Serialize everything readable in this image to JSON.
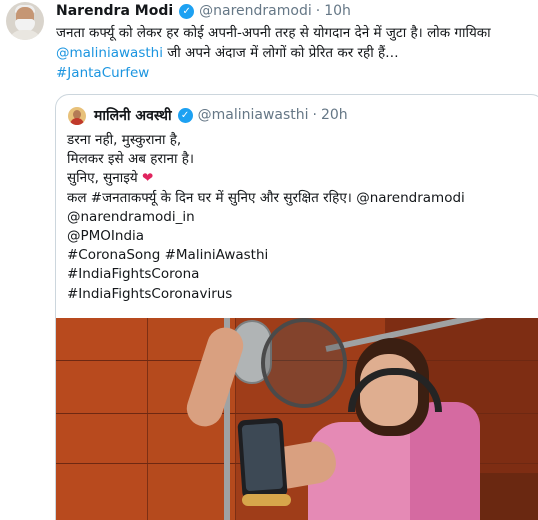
{
  "tweet": {
    "author_name": "Narendra Modi",
    "author_handle": "@narendramodi",
    "separator": "·",
    "time": "10h",
    "verified_icon": "verified-badge-icon",
    "text_before_mention": "जनता कर्फ्यू को लेकर हर कोई अपनी-अपनी तरह से योगदान देने में जुटा है। लोक गायिका ",
    "mention": "@maliniawasthi",
    "text_after_mention": " जी अपने अंदाज में लोगों को प्रेरित कर रही हैं…",
    "hashtag": "#JantaCurfew"
  },
  "quote": {
    "author_name": "मालिनी अवस्थी",
    "author_handle": "@maliniawasthi",
    "separator": "·",
    "time": "20h",
    "verified_icon": "verified-badge-icon",
    "lines": [
      "डरना नही, मुस्कुराना है,",
      "मिलकर इसे अब हराना है।",
      "सुनिए, सुनाइये",
      "कल #जनताकर्फ्यू के दिन घर में सुनिए और सुरक्षित रहिए। @narendramodi",
      "@narendramodi_in",
      "@PMOIndia",
      "#CoronaSong  #MaliniAwasthi",
      "#IndiaFightsCorona",
      "#IndiaFightsCoronavirus"
    ],
    "heart_glyph": "❤",
    "media": {
      "type": "video",
      "description_icon": "video-thumbnail"
    }
  },
  "colors": {
    "link": "#1b95e0",
    "verified": "#1da1f2",
    "muted": "#657786",
    "border": "#ccd6dd",
    "heart": "#e0245e"
  }
}
